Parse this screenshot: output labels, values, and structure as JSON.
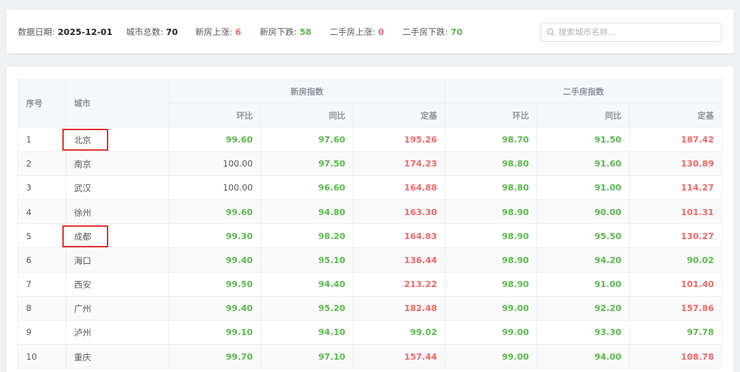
{
  "summary": {
    "date_label": "数据日期:",
    "date_value": "2025-12-01",
    "total_label": "城市总数:",
    "total_value": "70",
    "new_up_label": "新房上涨:",
    "new_up_value": "6",
    "new_down_label": "新房下跌:",
    "new_down_value": "58",
    "used_up_label": "二手房上涨:",
    "used_up_value": "0",
    "used_down_label": "二手房下跌:",
    "used_down_value": "70"
  },
  "search": {
    "placeholder": "搜索城市名称...",
    "value": ""
  },
  "table": {
    "headers": {
      "index": "序号",
      "city": "城市",
      "new_group": "新房指数",
      "used_group": "二手房指数",
      "mom": "环比",
      "yoy": "同比",
      "base": "定基"
    },
    "rows": [
      {
        "no": "1",
        "city": "北京",
        "new": {
          "mom": "99.60",
          "yoy": "97.60",
          "base": "195.26"
        },
        "used": {
          "mom": "98.70",
          "yoy": "91.50",
          "base": "187.42"
        }
      },
      {
        "no": "2",
        "city": "南京",
        "new": {
          "mom": "100.00",
          "yoy": "97.50",
          "base": "174.23"
        },
        "used": {
          "mom": "98.80",
          "yoy": "91.60",
          "base": "130.89"
        }
      },
      {
        "no": "3",
        "city": "武汉",
        "new": {
          "mom": "100.00",
          "yoy": "96.60",
          "base": "164.88"
        },
        "used": {
          "mom": "98.80",
          "yoy": "91.00",
          "base": "114.27"
        }
      },
      {
        "no": "4",
        "city": "徐州",
        "new": {
          "mom": "99.60",
          "yoy": "94.80",
          "base": "163.30"
        },
        "used": {
          "mom": "98.90",
          "yoy": "90.00",
          "base": "101.31"
        }
      },
      {
        "no": "5",
        "city": "成都",
        "new": {
          "mom": "99.30",
          "yoy": "98.20",
          "base": "164.83"
        },
        "used": {
          "mom": "98.90",
          "yoy": "95.50",
          "base": "130.27"
        }
      },
      {
        "no": "6",
        "city": "海口",
        "new": {
          "mom": "99.40",
          "yoy": "95.10",
          "base": "136.44"
        },
        "used": {
          "mom": "98.90",
          "yoy": "94.20",
          "base": "90.02"
        }
      },
      {
        "no": "7",
        "city": "西安",
        "new": {
          "mom": "99.50",
          "yoy": "94.40",
          "base": "213.22"
        },
        "used": {
          "mom": "98.90",
          "yoy": "91.00",
          "base": "101.40"
        }
      },
      {
        "no": "8",
        "city": "广州",
        "new": {
          "mom": "99.40",
          "yoy": "95.20",
          "base": "182.48"
        },
        "used": {
          "mom": "99.00",
          "yoy": "92.20",
          "base": "157.86"
        }
      },
      {
        "no": "9",
        "city": "泸州",
        "new": {
          "mom": "99.10",
          "yoy": "94.10",
          "base": "99.02"
        },
        "used": {
          "mom": "99.00",
          "yoy": "93.30",
          "base": "97.78"
        }
      },
      {
        "no": "10",
        "city": "重庆",
        "new": {
          "mom": "99.70",
          "yoy": "97.10",
          "base": "157.44"
        },
        "used": {
          "mom": "99.00",
          "yoy": "94.00",
          "base": "108.78"
        }
      }
    ]
  },
  "highlighted_cities": [
    "北京",
    "成都"
  ],
  "colors": {
    "up": "#ee6666",
    "down": "#58b84a",
    "highlight": "#dd1f1f"
  }
}
